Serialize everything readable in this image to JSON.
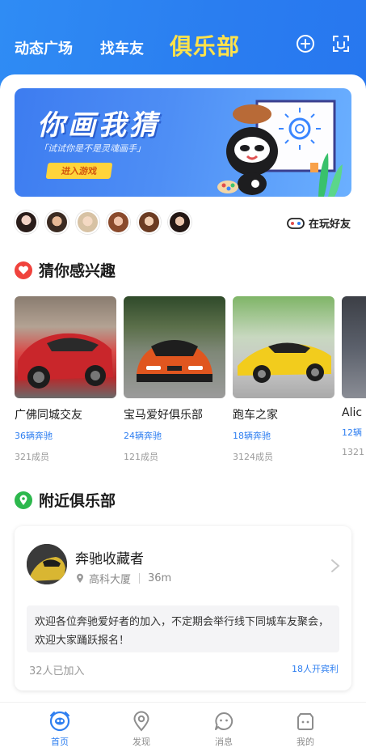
{
  "header": {
    "tabs": [
      {
        "label": "动态广场"
      },
      {
        "label": "找车友"
      },
      {
        "label": "俱乐部"
      }
    ],
    "active_tab": "俱乐部",
    "active_color": "#ffe24b",
    "bg_color": "#2f8cf4",
    "icons": [
      "plus-circle-icon",
      "scan-icon"
    ]
  },
  "banner": {
    "title": "你画我猜",
    "subtitle": "「试试你是不是灵魂画手」",
    "button": "进入游戏"
  },
  "players": {
    "avatar_count": 6,
    "label": "在玩好友",
    "icon": "gamepad-icon"
  },
  "interest": {
    "title": "猜你感兴趣",
    "icon": "heart-icon",
    "clubs": [
      {
        "name": "广佛同城交友",
        "count": "36辆奔驰",
        "members": "321成员"
      },
      {
        "name": "宝马爱好俱乐部",
        "count": "24辆奔驰",
        "members": "121成员"
      },
      {
        "name": "跑车之家",
        "count": "18辆奔驰",
        "members": "3124成员"
      },
      {
        "name": "Alic",
        "count": "12辆",
        "members": "1321"
      }
    ]
  },
  "nearby": {
    "title": "附近俱乐部",
    "icon": "location-pin-icon",
    "card": {
      "name": "奔驰收藏者",
      "location": "高科大厦",
      "distance": "36m",
      "description": "欢迎各位奔驰爱好者的加入，不定期会举行线下同城车友聚会，欢迎大家踊跃报名！",
      "joined": "32人已加入",
      "benefit": "18人开宾利"
    }
  },
  "bottom_nav": {
    "items": [
      {
        "label": "首页",
        "icon": "home-icon",
        "active": true
      },
      {
        "label": "发现",
        "icon": "discover-icon",
        "active": false
      },
      {
        "label": "消息",
        "icon": "message-icon",
        "active": false
      },
      {
        "label": "我的",
        "icon": "profile-icon",
        "active": false
      }
    ],
    "active_color": "#2f7ff0"
  }
}
